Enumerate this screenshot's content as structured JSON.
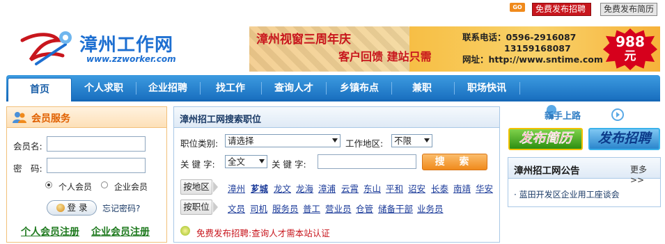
{
  "topbar": {
    "go_badge": "GO",
    "publish_job_btn": "免费发布招聘",
    "publish_resume_btn": "免费发布简历"
  },
  "logo": {
    "name": "漳州工作网",
    "url": "www.zzworker.com"
  },
  "banner": {
    "title": "漳州视窗三周年庆",
    "subtitle": "客户回馈 建站只需",
    "contact_label": "联系电话：0596-2916087",
    "contact_phone2": "13159168087",
    "website": "网址：http://www.sntime.com",
    "price": "988",
    "price_unit": "元"
  },
  "nav": {
    "items": [
      "首页",
      "个人求职",
      "企业招聘",
      "找工作",
      "查询人才",
      "乡镇布点",
      "兼职",
      "职场快讯"
    ]
  },
  "member": {
    "title": "会员服务",
    "username_label": "会员名:",
    "password_label": "密　码:",
    "username_value": "",
    "password_value": "",
    "radio_personal": "个人会员",
    "radio_company": "企业会员",
    "login_btn": "登 录",
    "forgot": "忘记密码?",
    "reg_personal": "个人会员注册",
    "reg_company": "企业会员注册"
  },
  "search": {
    "title": "漳州招工网搜索职位",
    "category_label": "职位类别:",
    "category_value": "请选择",
    "area_label": "工作地区:",
    "area_value": "不限",
    "keyword_label1": "关 键 字:",
    "keyword_select": "全文",
    "keyword_label2": "关 键 字:",
    "keyword_value": "",
    "search_btn": "搜 索",
    "by_area_btn": "按地区",
    "areas": [
      "漳州",
      "芗城",
      "龙文",
      "龙海",
      "漳浦",
      "云霄",
      "东山",
      "平和",
      "诏安",
      "长泰",
      "南靖",
      "华安"
    ],
    "by_job_btn": "按职位",
    "jobs": [
      "文员",
      "司机",
      "服务员",
      "普工",
      "营业员",
      "仓管",
      "储备干部",
      "业务员"
    ],
    "notice": "免费发布招聘:查询人才需本站认证"
  },
  "right": {
    "newbie": "新手上路",
    "publish_resume": "发布简历",
    "publish_job": "发布招聘",
    "announce_title": "漳州招工网公告",
    "more": "更多>>",
    "announce_items": [
      "· 蓝田开发区企业用工座谈会"
    ]
  },
  "colors": {
    "nav_blue": "#1a70c0",
    "brand_red": "#c8161d",
    "member_orange": "#e06000",
    "link_green": "#1f7a1f"
  }
}
